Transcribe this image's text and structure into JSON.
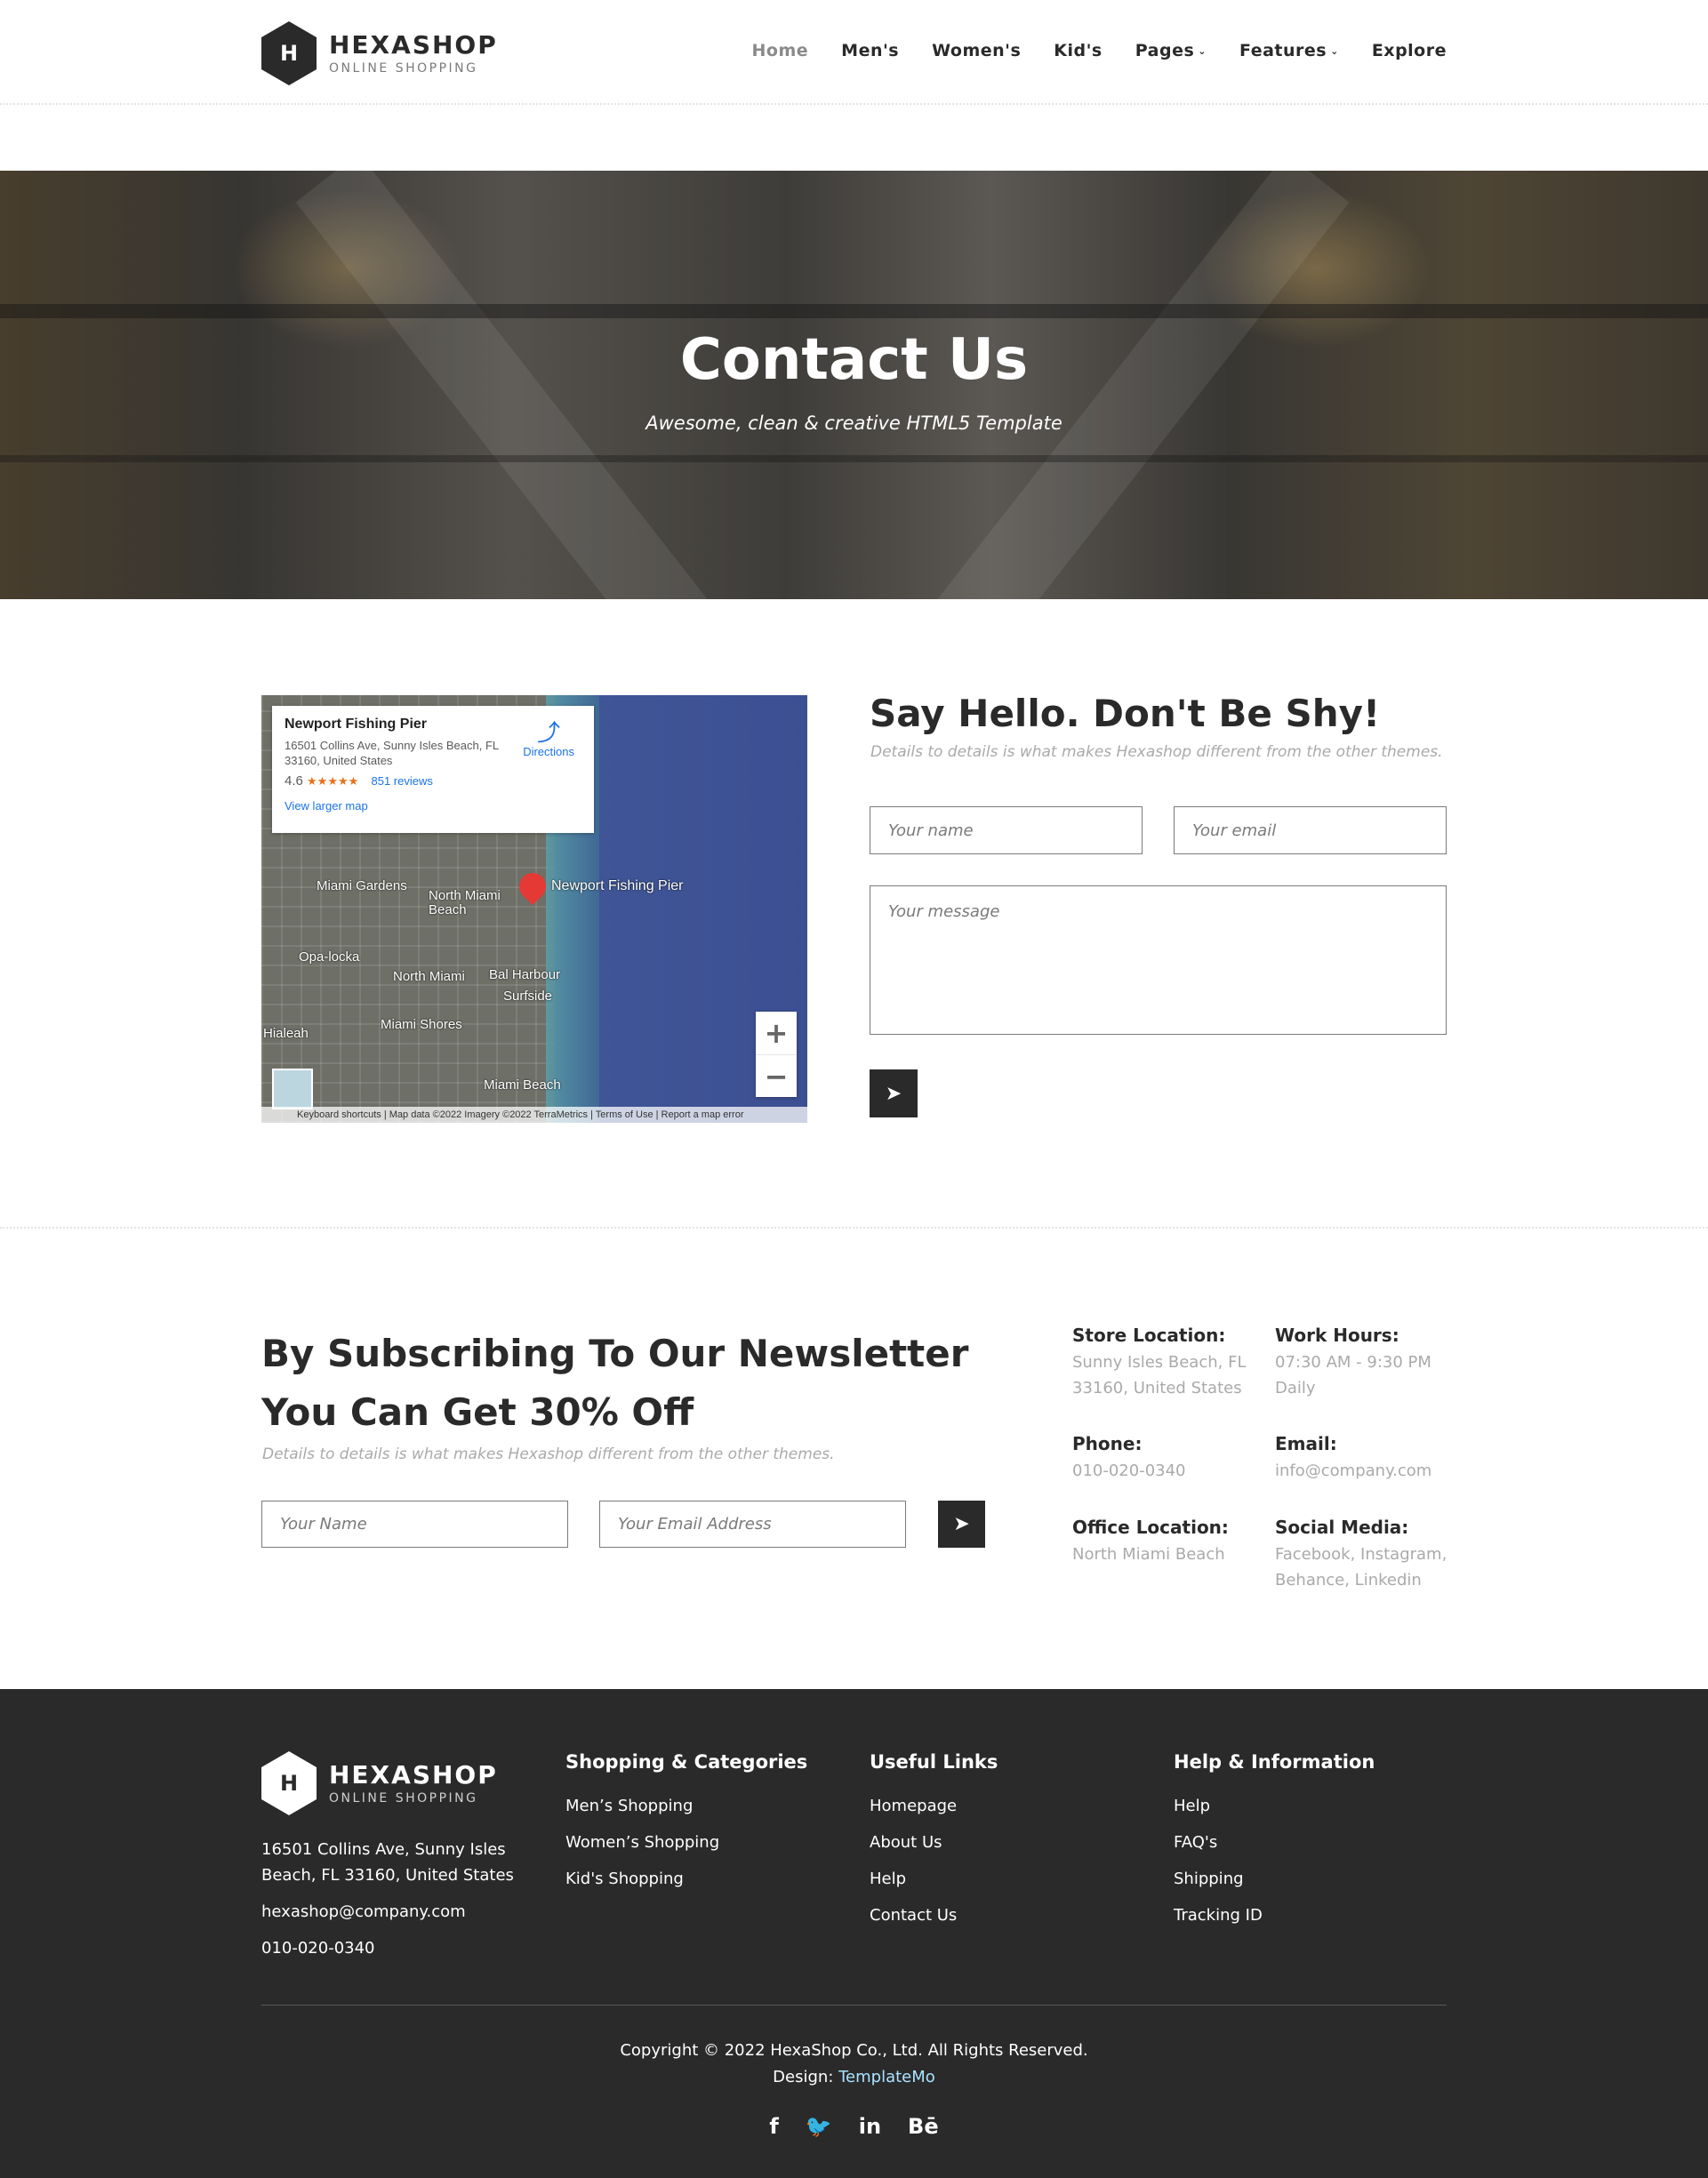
{
  "brand": {
    "name": "HEXASHOP",
    "tagline": "ONLINE SHOPPING",
    "mark": "H"
  },
  "nav": {
    "home": "Home",
    "mens": "Men's",
    "womens": "Women's",
    "kids": "Kid's",
    "pages": "Pages",
    "features": "Features",
    "explore": "Explore",
    "active": "Home",
    "caret_icon": "chevron-down-icon"
  },
  "hero": {
    "title": "Contact Us",
    "subtitle": "Awesome, clean & creative HTML5 Template"
  },
  "map": {
    "place": "Newport Fishing Pier",
    "address": "16501 Collins Ave, Sunny Isles Beach, FL 33160, United States",
    "rating": "4.6",
    "stars": "★★★★★",
    "reviews": "851 reviews",
    "directions": "Directions",
    "larger_map": "View larger map",
    "labels": {
      "miami_gardens": "Miami Gardens",
      "north_miami_beach": "North Miami Beach",
      "opa_locka": "Opa-locka",
      "north_miami": "North Miami",
      "bal_harbour": "Bal Harbour",
      "surfside": "Surfside",
      "miami_shores": "Miami Shores",
      "hialeah": "Hialeah",
      "miami_beach": "Miami Beach"
    },
    "zoom_in": "+",
    "zoom_out": "−",
    "footer": "Keyboard shortcuts  |  Map data ©2022 Imagery ©2022 TerraMetrics  |  Terms of Use  |  Report a map error"
  },
  "contact": {
    "title": "Say Hello. Don't Be Shy!",
    "subtitle": "Details to details is what makes Hexashop different from the other themes.",
    "name_placeholder": "Your name",
    "email_placeholder": "Your email",
    "message_placeholder": "Your message",
    "send_icon": "paper-plane-icon"
  },
  "newsletter": {
    "title": "By Subscribing To Our Newsletter You Can Get 30% Off",
    "subtitle": "Details to details is what makes Hexashop different from the other themes.",
    "name_placeholder": "Your Name",
    "email_placeholder": "Your Email Address"
  },
  "info": {
    "store_label": "Store Location:",
    "store_value": "Sunny Isles Beach, FL 33160, United States",
    "hours_label": "Work Hours:",
    "hours_value": "07:30 AM - 9:30 PM Daily",
    "phone_label": "Phone:",
    "phone_value": "010-020-0340",
    "email_label": "Email:",
    "email_value": "info@company.com",
    "office_label": "Office Location:",
    "office_value": "North Miami Beach",
    "social_label": "Social Media:",
    "social_value": "Facebook, Instagram, Behance, Linkedin"
  },
  "footer": {
    "address": "16501 Collins Ave, Sunny Isles Beach, FL 33160, United States",
    "email": "hexashop@company.com",
    "phone": "010-020-0340",
    "col1_head": "Shopping & Categories",
    "col1": [
      "Men’s Shopping",
      "Women’s Shopping",
      "Kid's Shopping"
    ],
    "col2_head": "Useful Links",
    "col2": [
      "Homepage",
      "About Us",
      "Help",
      "Contact Us"
    ],
    "col3_head": "Help & Information",
    "col3": [
      "Help",
      "FAQ's",
      "Shipping",
      "Tracking ID"
    ],
    "copyright": "Copyright © 2022 HexaShop Co., Ltd. All Rights Reserved.",
    "design_label": "Design:",
    "design_link": "TemplateMo",
    "social": {
      "facebook": "f",
      "twitter": "🐦",
      "linkedin": "in",
      "behance": "Bē"
    }
  },
  "colors": {
    "dark": "#2a2a2a",
    "muted": "#aaaaaa",
    "link": "#a9e3ff",
    "map_link": "#1a73e8"
  }
}
